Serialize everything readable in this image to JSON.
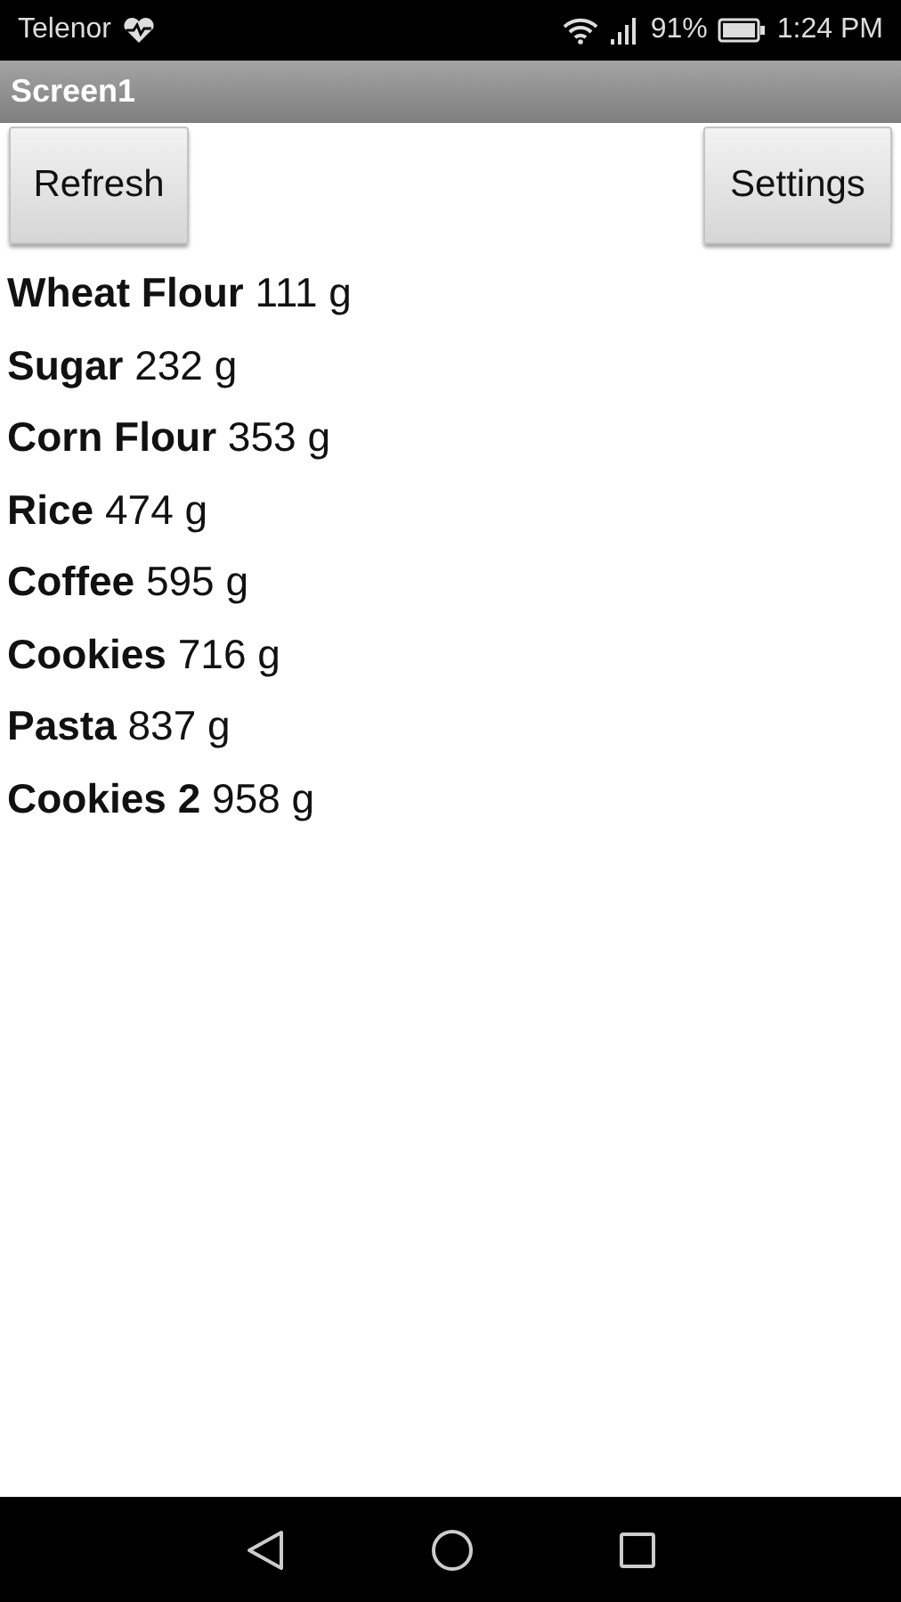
{
  "status_bar": {
    "carrier": "Telenor",
    "battery": "91%",
    "time": "1:24 PM"
  },
  "title_bar": {
    "title": "Screen1"
  },
  "buttons": [
    {
      "label": "Refresh"
    },
    {
      "label": "Settings"
    }
  ],
  "items": [
    {
      "text": "**Wheat Flour** 111 g"
    },
    {
      "text": "**Sugar** 232 g"
    },
    {
      "text": "**Corn Flour** 353 g"
    },
    {
      "text": "**Rice** 474 g"
    },
    {
      "text": "**Coffee** 595 g"
    },
    {
      "text": "**Cookies** 716 g"
    },
    {
      "text": "**Pasta** 837 g"
    },
    {
      "text": "**Cookies 2** 958 g"
    }
  ]
}
